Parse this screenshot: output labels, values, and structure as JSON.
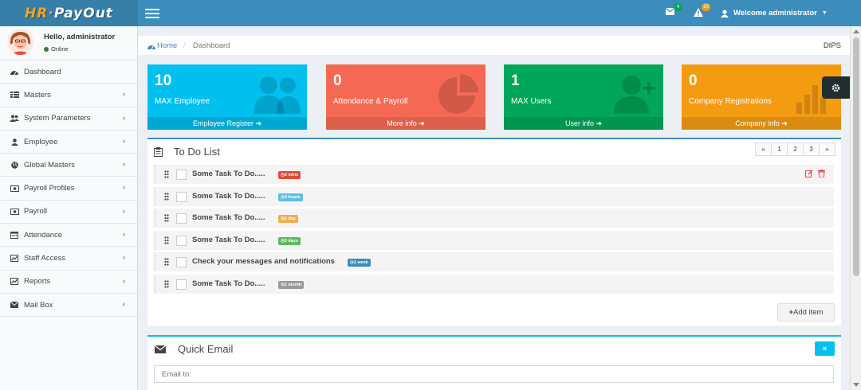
{
  "app": {
    "logo_hr": "HR",
    "logo_rest": "PayOut"
  },
  "navbar": {
    "mail_badge": "4",
    "alert_badge": "10",
    "welcome": "Welcome administrator"
  },
  "user_panel": {
    "greeting": "Hello, administrator",
    "status": "Online"
  },
  "sidebar": {
    "items": [
      {
        "label": "Dashboard",
        "icon": "dashboard-icon"
      },
      {
        "label": "Masters",
        "icon": "table-icon"
      },
      {
        "label": "System Parameters",
        "icon": "users-icon"
      },
      {
        "label": "Employee",
        "icon": "user-icon"
      },
      {
        "label": "Global Masters",
        "icon": "globe-icon"
      },
      {
        "label": "Payroll Profiles",
        "icon": "money-icon"
      },
      {
        "label": "Payroll",
        "icon": "money-icon"
      },
      {
        "label": "Attendance",
        "icon": "calendar-icon"
      },
      {
        "label": "Staff Access",
        "icon": "chart-icon"
      },
      {
        "label": "Reports",
        "icon": "chart-icon"
      },
      {
        "label": "Mail Box",
        "icon": "envelope-icon"
      }
    ]
  },
  "breadcrumb": {
    "home": "Home",
    "separator": "/",
    "current": "Dashboard",
    "right": "DIPS"
  },
  "stats": [
    {
      "value": "10",
      "label": "MAX Employee",
      "footer": "Employee Register",
      "color": "#00c0ef",
      "footer_color": "#00a7d0"
    },
    {
      "value": "0",
      "label": "Attendance & Payroll",
      "footer": "More info",
      "color": "#f56954",
      "footer_color": "#dc5f4c"
    },
    {
      "value": "1",
      "label": "MAX Users",
      "footer": "User info",
      "color": "#00a65a",
      "footer_color": "#009551"
    },
    {
      "value": "0",
      "label": "Company Registrations",
      "footer": "Company info",
      "color": "#f39c12",
      "footer_color": "#da8c10"
    }
  ],
  "todo": {
    "title": "To Do List",
    "pages": [
      "«",
      "1",
      "2",
      "3",
      "»"
    ],
    "items": [
      {
        "text": "Some Task To Do.....",
        "label": "2 mins",
        "color": "#dd4b39"
      },
      {
        "text": "Some Task To Do.....",
        "label": "4 hours",
        "color": "#5bc0de"
      },
      {
        "text": "Some Task To Do.....",
        "label": "1 day",
        "color": "#f0ad4e"
      },
      {
        "text": "Some Task To Do.....",
        "label": "3 days",
        "color": "#5cb85c"
      },
      {
        "text": "Check your messages and notifications",
        "label": "1 week",
        "color": "#3c8dbc"
      },
      {
        "text": "Some Task To Do.....",
        "label": "1 month",
        "color": "#999999"
      }
    ],
    "add_item": "Add item"
  },
  "quick_email": {
    "title": "Quick Email",
    "close": "×",
    "email_placeholder": "Email to:"
  }
}
